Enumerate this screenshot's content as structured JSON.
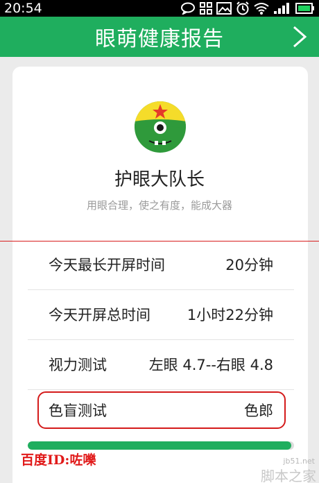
{
  "status_bar": {
    "time": "20:54",
    "icons": [
      "chat-bubble-icon",
      "grid-icon",
      "image-icon",
      "alarm-icon",
      "wifi-icon",
      "signal-icon",
      "battery-icon"
    ]
  },
  "header": {
    "title": "眼萌健康报告",
    "next_icon": "chevron-right-icon"
  },
  "profile": {
    "rank_title": "护眼大队长",
    "motto": "用眼合理，使之有度，能成大器"
  },
  "stats": [
    {
      "label": "今天最长开屏时间",
      "value": "20分钟"
    },
    {
      "label": "今天开屏总时间",
      "value": "1小时22分钟"
    },
    {
      "label": "视力测试",
      "value": "左眼 4.7--右眼 4.8"
    },
    {
      "label": "色盲测试",
      "value": "色郎"
    }
  ],
  "progress": {
    "fraction": 0.99
  },
  "watermark": {
    "baidu_id": "百度ID:咗嚛",
    "jb": "jb51.net",
    "site": "脚本之家"
  },
  "colors": {
    "brand_green": "#1fae5e",
    "highlight_red": "#d41a1a"
  }
}
